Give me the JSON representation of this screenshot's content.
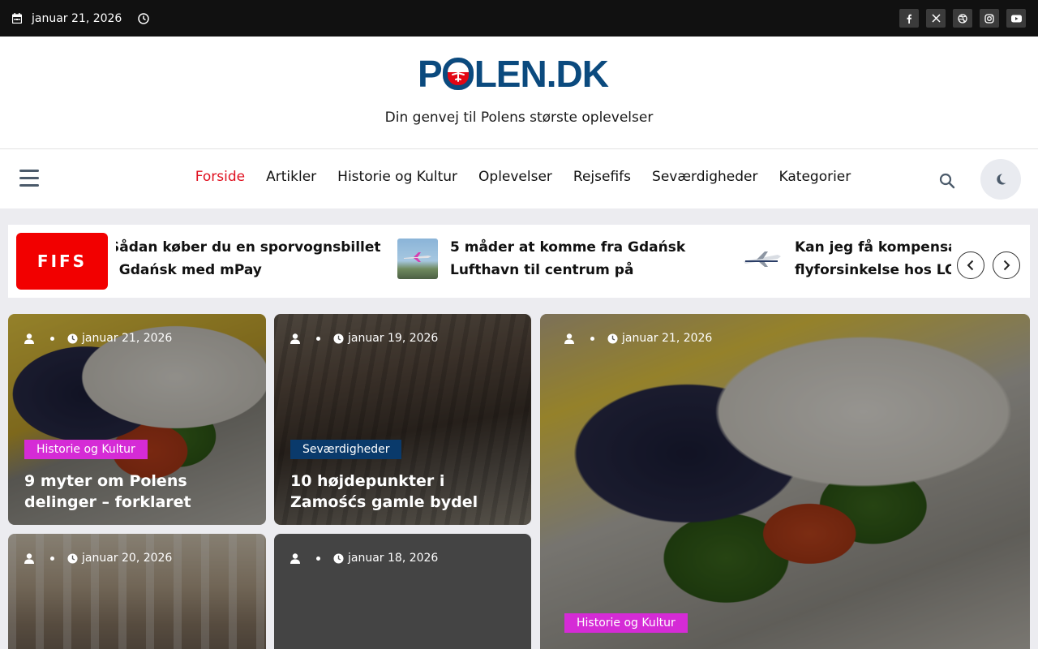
{
  "topbar": {
    "date": "januar 21, 2026",
    "social_icons": [
      "facebook-icon",
      "x-twitter-icon",
      "dribbble-icon",
      "instagram-icon",
      "youtube-icon"
    ]
  },
  "header": {
    "logo_text_1": "P",
    "logo_text_2": "LEN.DK",
    "tagline": "Din genvej til Polens største oplevelser"
  },
  "nav": {
    "items": [
      {
        "label": "Forside",
        "active": true
      },
      {
        "label": "Artikler"
      },
      {
        "label": "Historie og Kultur"
      },
      {
        "label": "Oplevelser"
      },
      {
        "label": "Rejsefifs"
      },
      {
        "label": "Seværdigheder"
      },
      {
        "label": "Kategorier"
      }
    ]
  },
  "ticker": {
    "label": "FIFS",
    "items": [
      {
        "title": "Sådan køber du en sporvognsbillet i Gdańsk med mPay"
      },
      {
        "title": "5 måder at komme fra Gdańsk Lufthavn til centrum på"
      },
      {
        "title": "Kan jeg få kompensation for flyforsinkelse hos LOT?"
      }
    ]
  },
  "cards": [
    {
      "date": "januar 21, 2026",
      "category": "Historie og Kultur",
      "title": "9 myter om Polens delinger – forklaret"
    },
    {
      "date": "januar 19, 2026",
      "category": "Seværdigheder",
      "title": "10 højdepunkter i Zamośćs gamle bydel"
    },
    {
      "date": "januar 21, 2026",
      "category": "Historie og Kultur",
      "title": ""
    },
    {
      "date": "januar 20, 2026"
    },
    {
      "date": "januar 18, 2026"
    }
  ],
  "colors": {
    "accent_red": "#e0101f",
    "category_magenta": "#d52bd6",
    "category_navy": "#0a3a6b",
    "logo_blue": "#0b4a7e"
  }
}
